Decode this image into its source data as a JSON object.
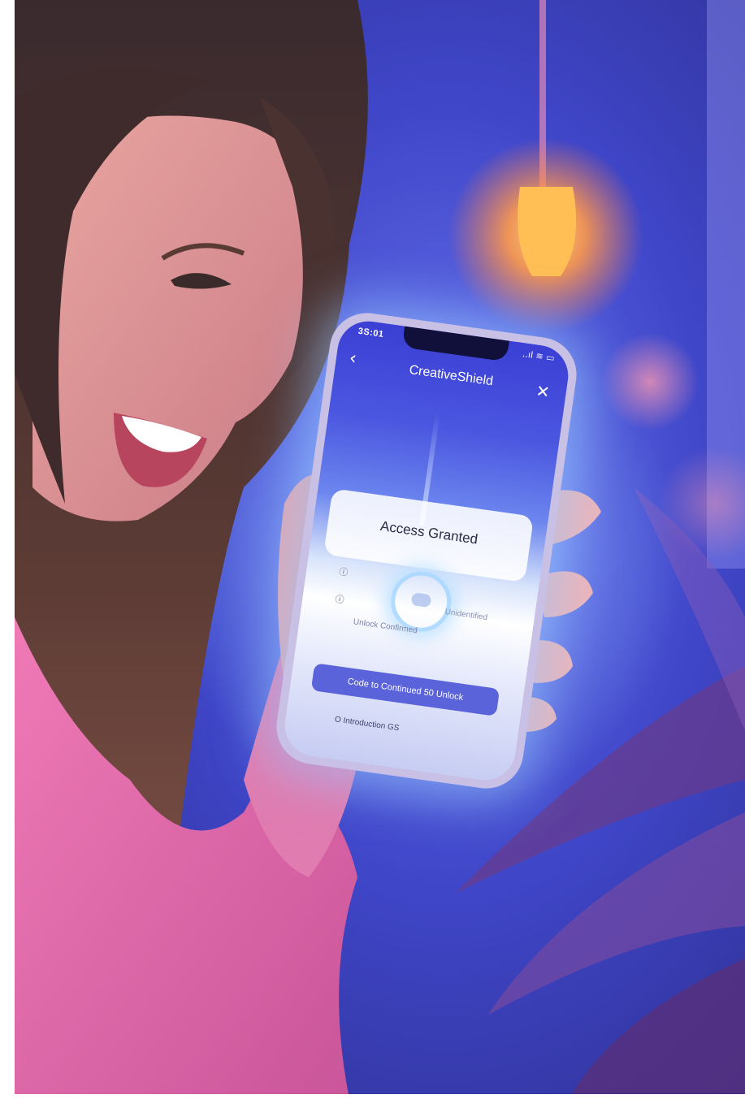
{
  "phone": {
    "status_time": "3S:01",
    "status_icons": "..ıl ≋ ▭",
    "title": "CreativeShield",
    "card_title": "Access Granted",
    "side_text": "Unidentified",
    "sub_text": "Unlock Confirmed",
    "button_label": "Code to Continued 50 Unlock",
    "footer_text": "O  Introduction  GS",
    "info_icon": "ⓘ",
    "back_icon": "chevron-left-icon",
    "close_icon": "close-icon"
  },
  "scene": {
    "description_colors": {
      "background": "#3a3fb8",
      "sweater": "#e46aa8",
      "lamp": "#ffb04a"
    }
  }
}
